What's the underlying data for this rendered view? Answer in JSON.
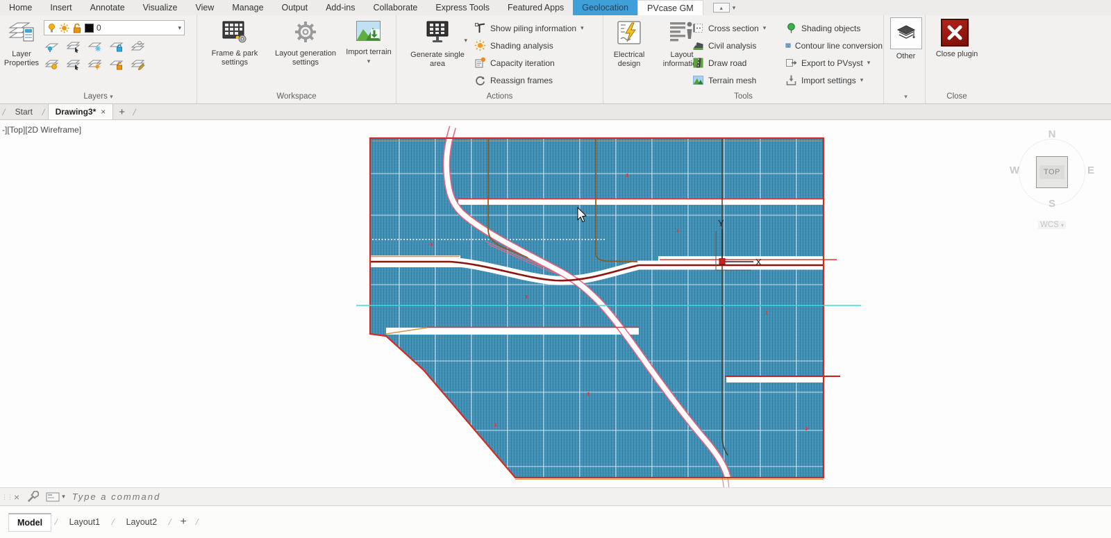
{
  "menu": {
    "items": [
      "Home",
      "Insert",
      "Annotate",
      "Visualize",
      "View",
      "Manage",
      "Output",
      "Add-ins",
      "Collaborate",
      "Express Tools",
      "Featured Apps"
    ],
    "geolocation_tab": "Geolocation",
    "pvcase_tab": "PVcase GM"
  },
  "ribbon": {
    "layers": {
      "panel_label": "Layers",
      "layer_properties": "Layer Properties",
      "current_layer_name": "0"
    },
    "workspace": {
      "panel_label": "Workspace",
      "frame_park_settings": "Frame & park settings",
      "layout_generation_settings": "Layout generation settings",
      "import_terrain": "Import terrain"
    },
    "actions": {
      "panel_label": "Actions",
      "generate_single_area": "Generate single area",
      "show_piling_information": "Show piling information",
      "shading_analysis": "Shading analysis",
      "capacity_iteration": "Capacity iteration",
      "reassign_frames": "Reassign frames"
    },
    "tools": {
      "panel_label": "Tools",
      "electrical_design": "Electrical design",
      "layout_information": "Layout information",
      "cross_section": "Cross section",
      "civil_analysis": "Civil analysis",
      "draw_road": "Draw road",
      "terrain_mesh": "Terrain mesh",
      "shading_objects": "Shading objects",
      "contour_line_conversion": "Contour line conversion",
      "export_to_pvsyst": "Export to PVsyst",
      "import_settings": "Import settings"
    },
    "other": {
      "button_label": "Other"
    },
    "close": {
      "panel_label": "Close",
      "button_label": "Close plugin"
    }
  },
  "file_tabs": {
    "start": "Start",
    "active_drawing": "Drawing3*"
  },
  "viewport": {
    "label": "-][Top][2D Wireframe]",
    "ucs_x_label": "X",
    "ucs_y_label": "Y"
  },
  "viewcube": {
    "north": "N",
    "west": "W",
    "east": "E",
    "south": "S",
    "top": "TOP",
    "wcs": "WCS"
  },
  "command_bar": {
    "placeholder": "Type a command"
  },
  "layout_bar": {
    "model": "Model",
    "layout1": "Layout1",
    "layout2": "Layout2"
  },
  "glyphs": {
    "dropdown": "▾",
    "up_small": "▴",
    "close": "×",
    "plus": "+",
    "slash": "/",
    "grip": "⋮⋮"
  },
  "colors": {
    "menu_highlight_blue": "#3f9fd8",
    "panel_blue": "#4293b8",
    "boundary_red": "#d42b20",
    "cyan_line": "#35dde4",
    "close_button_red": "#8e1513",
    "road_pink": "#ef5f78",
    "spine_dark_red": "#8e150f",
    "brown_line": "#8a5a20"
  }
}
